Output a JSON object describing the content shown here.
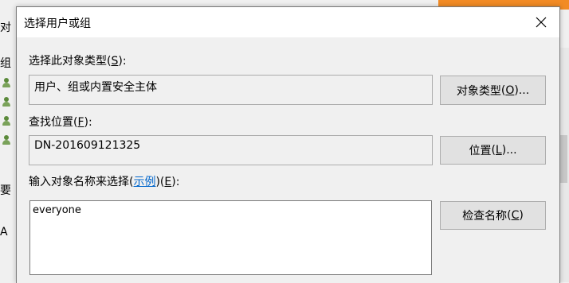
{
  "background": {
    "fragments": [
      "对",
      "组",
      "要",
      "A"
    ]
  },
  "dialog": {
    "title": "选择用户或组",
    "object_type": {
      "label": "选择此对象类型",
      "accesskey": "S",
      "value": "用户、组或内置安全主体",
      "button": "对象类型",
      "button_accesskey": "O"
    },
    "location": {
      "label": "查找位置",
      "accesskey": "F",
      "value": "DN-201609121325",
      "button": "位置",
      "button_accesskey": "L"
    },
    "names": {
      "label": "输入对象名称来选择",
      "examples_link": "示例",
      "accesskey": "E",
      "value": "everyone",
      "button": "检查名称",
      "button_accesskey": "C"
    }
  }
}
